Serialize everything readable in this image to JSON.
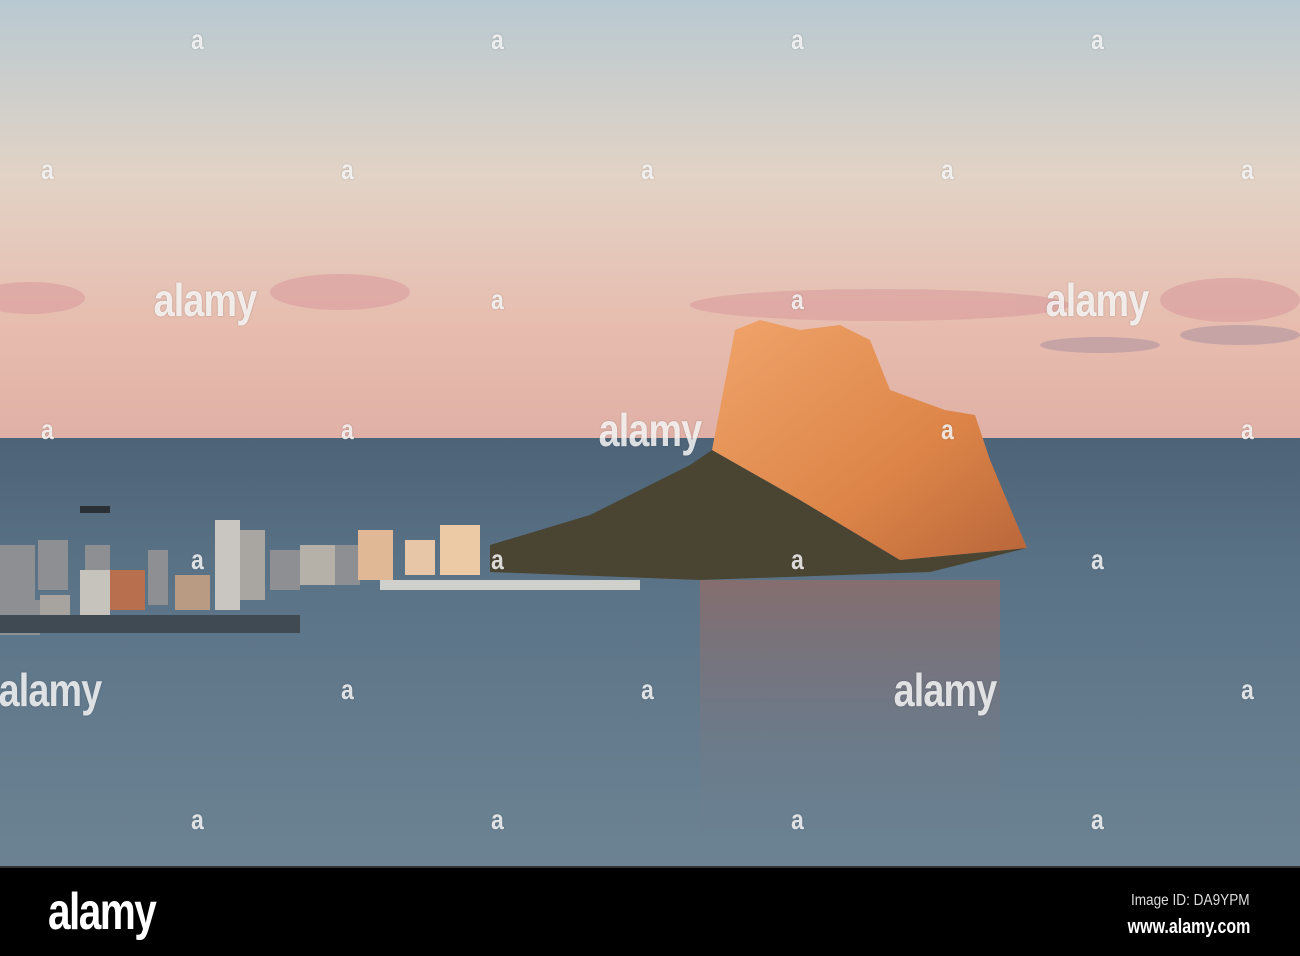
{
  "watermark": {
    "word": "alamy",
    "glyph": "a"
  },
  "footer": {
    "logo": "alamy",
    "image_id": "Image ID: DA9YPM",
    "url": "www.alamy.com"
  },
  "colors": {
    "sky_top": "#b8c9d1",
    "sky_mid": "#e2d3c6",
    "sky_low": "#e4b6aa",
    "sea": "#5a7084",
    "rock_lit": "#e08a4e",
    "footer_bg": "#000000"
  }
}
